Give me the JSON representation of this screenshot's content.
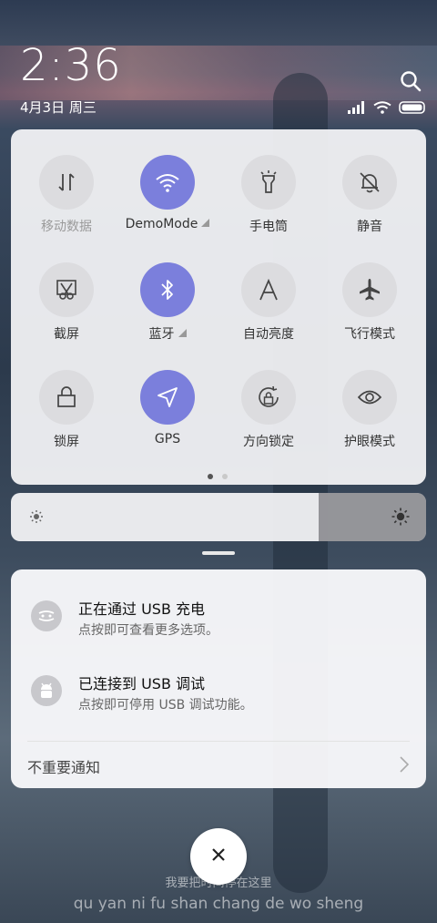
{
  "status": {
    "time": "2:36",
    "date": "4月3日 周三"
  },
  "tiles": [
    {
      "label": "移动数据",
      "icon": "mobile-data-icon",
      "active": false
    },
    {
      "label": "DemoMode",
      "icon": "wifi-icon",
      "active": true
    },
    {
      "label": "手电筒",
      "icon": "flashlight-icon",
      "active": false
    },
    {
      "label": "静音",
      "icon": "mute-bell-icon",
      "active": false
    },
    {
      "label": "截屏",
      "icon": "screenshot-icon",
      "active": false
    },
    {
      "label": "蓝牙",
      "icon": "bluetooth-icon",
      "active": true
    },
    {
      "label": "自动亮度",
      "icon": "auto-brightness-icon",
      "active": false
    },
    {
      "label": "飞行模式",
      "icon": "airplane-icon",
      "active": false
    },
    {
      "label": "锁屏",
      "icon": "lock-icon",
      "active": false
    },
    {
      "label": "GPS",
      "icon": "gps-icon",
      "active": true
    },
    {
      "label": "方向锁定",
      "icon": "rotation-lock-icon",
      "active": false
    },
    {
      "label": "护眼模式",
      "icon": "eye-icon",
      "active": false
    }
  ],
  "notifications": [
    {
      "title": "正在通过 USB 充电",
      "subtitle": "点按即可查看更多选项。"
    },
    {
      "title": "已连接到 USB 调试",
      "subtitle": "点按即可停用 USB 调试功能。"
    }
  ],
  "unimportant_label": "不重要通知",
  "wallpaper_caption": {
    "line1": "我要把时间停在这里",
    "line2": "qu yan ni fu shan chang de wo sheng"
  },
  "colors": {
    "active_tile": "#7b7fdc",
    "inactive_tile": "#dcdcdf"
  }
}
